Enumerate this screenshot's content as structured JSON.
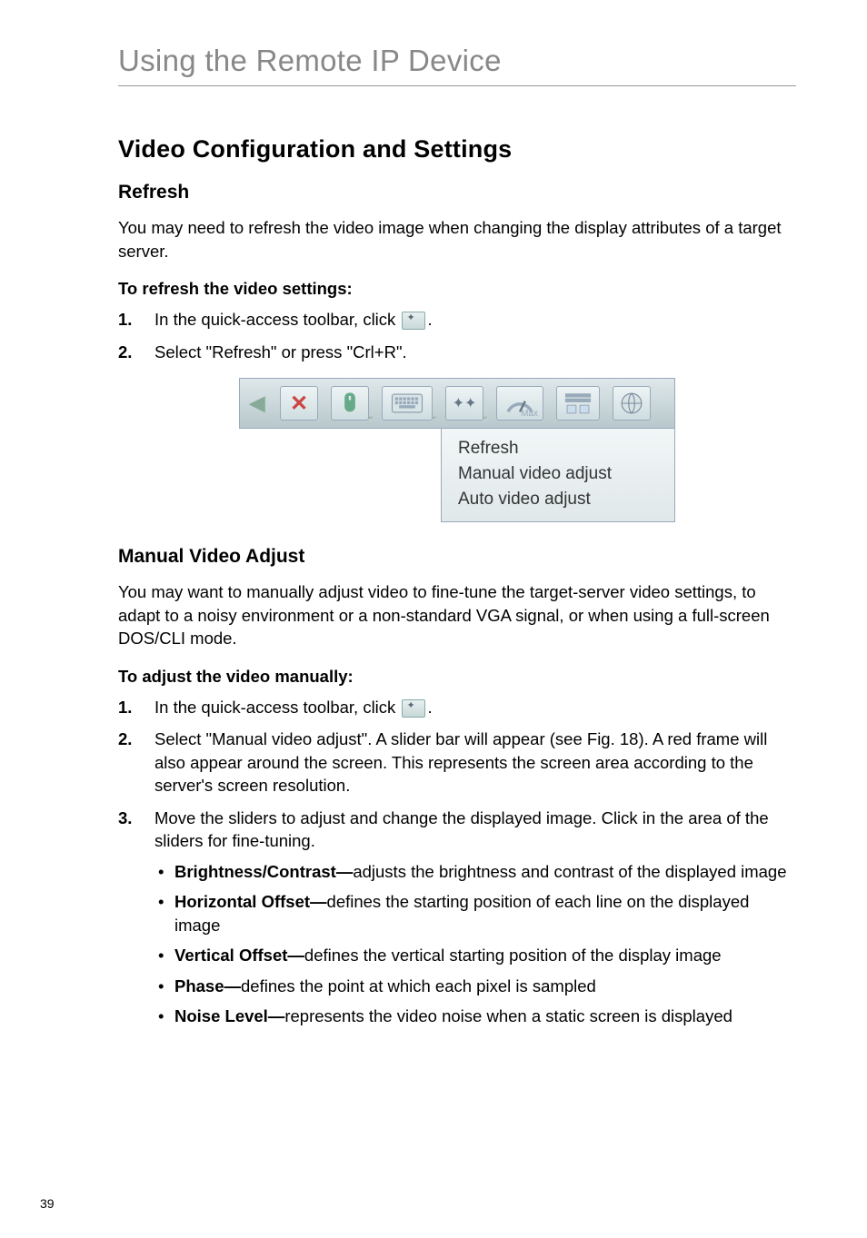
{
  "page_number": "39",
  "page_title": "Using the Remote IP Device",
  "section_title": "Video Configuration and Settings",
  "refresh": {
    "heading": "Refresh",
    "intro": "You may need to refresh the video image when changing the display attributes of a target server.",
    "howto_heading": "To refresh the video settings:",
    "step1_pre": "In the quick-access toolbar, click ",
    "step1_post": ".",
    "step2": "Select \"Refresh\" or press \"Crl+R\"."
  },
  "toolbar_menu": {
    "items": [
      "Refresh",
      "Manual video adjust",
      "Auto video adjust"
    ],
    "max_label": "Max"
  },
  "manual": {
    "heading": "Manual Video Adjust",
    "intro": "You may want to manually adjust video to fine-tune the target-server video settings, to adapt to a noisy environment or a non-standard VGA signal, or when using a full-screen DOS/CLI mode.",
    "howto_heading": "To adjust the video manually:",
    "step1_pre": "In the quick-access toolbar, click ",
    "step1_post": ".",
    "step2": "Select \"Manual video adjust\". A slider bar will appear (see Fig. 18). A red frame will also appear around the screen. This represents the screen area according to the server's screen resolution.",
    "step3_intro": "Move the sliders to adjust and change the displayed image. Click in the area of the sliders for fine-tuning.",
    "bullets": [
      {
        "label": "Brightness/Contrast—",
        "text": "adjusts the brightness and contrast of the displayed image"
      },
      {
        "label": "Horizontal Offset—",
        "text": "defines the starting position of each line on the displayed image"
      },
      {
        "label": "Vertical Offset—",
        "text": "defines the vertical starting position of the display image"
      },
      {
        "label": "Phase—",
        "text": "defines the point at which each pixel is sampled"
      },
      {
        "label": "Noise Level—",
        "text": "represents the video noise when a static screen is displayed"
      }
    ]
  }
}
